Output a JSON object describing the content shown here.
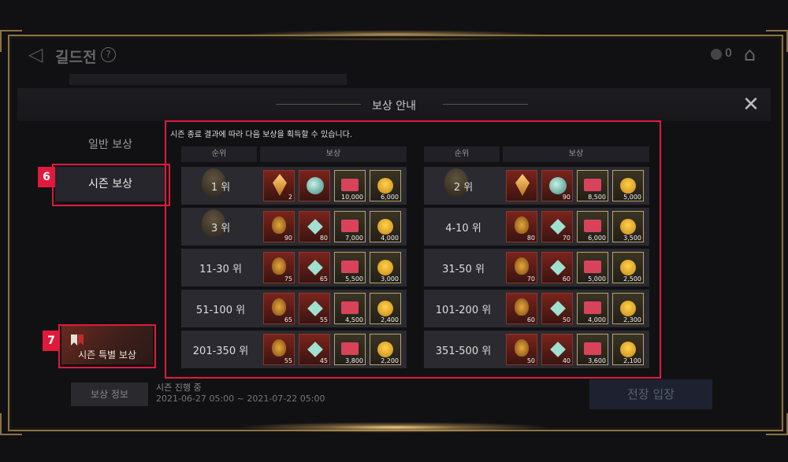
{
  "header": {
    "title": "길드전",
    "help": "?",
    "coin_count": "0"
  },
  "panel": {
    "title": "보상 안내",
    "close": "✕"
  },
  "tabs": {
    "general": "일반 보상",
    "season": "시즌 보상",
    "special": "시즌 특별 보상"
  },
  "badges": {
    "six": "6",
    "seven": "7"
  },
  "intro": "시즌 종료 결과에 따라 다음 보상을 획득할 수 있습니다.",
  "columns": {
    "rank": "순위",
    "reward": "보상"
  },
  "left_rows": [
    {
      "rank": "1 위",
      "q": [
        "2",
        "",
        "10,000",
        "6,000"
      ]
    },
    {
      "rank": "3 위",
      "q": [
        "90",
        "80",
        "7,000",
        "4,000"
      ]
    },
    {
      "rank": "11-30 위",
      "q": [
        "75",
        "65",
        "5,500",
        "3,000"
      ]
    },
    {
      "rank": "51-100 위",
      "q": [
        "65",
        "55",
        "4,500",
        "2,400"
      ]
    },
    {
      "rank": "201-350 위",
      "q": [
        "55",
        "45",
        "3,800",
        "2,200"
      ]
    }
  ],
  "right_rows": [
    {
      "rank": "2 위",
      "q": [
        "",
        "90",
        "8,500",
        "5,000"
      ]
    },
    {
      "rank": "4-10 위",
      "q": [
        "80",
        "70",
        "6,000",
        "3,500"
      ]
    },
    {
      "rank": "31-50 위",
      "q": [
        "70",
        "60",
        "5,000",
        "2,500"
      ]
    },
    {
      "rank": "101-200 위",
      "q": [
        "60",
        "50",
        "4,000",
        "2,300"
      ]
    },
    {
      "rank": "351-500 위",
      "q": [
        "50",
        "40",
        "3,600",
        "2,100"
      ]
    }
  ],
  "footer": {
    "reward_info": "보상 정보",
    "status": "시즌 진행 중",
    "dates": "2021-06-27 05:00 ~ 2021-07-22 05:00",
    "enter": "전장 입장"
  },
  "colors": {
    "highlight": "#e11a3c",
    "frame_gold": "#8a7344"
  }
}
